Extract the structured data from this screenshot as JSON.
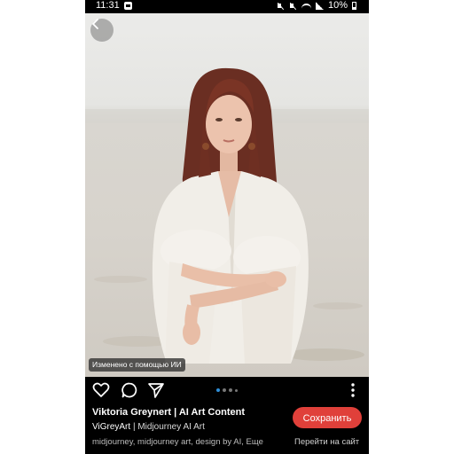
{
  "status_bar": {
    "time": "11:31",
    "battery": "10%"
  },
  "photo": {
    "ai_label": "Изменено с помощью ИИ"
  },
  "pagination": {
    "total": 4,
    "active_index": 0
  },
  "pin": {
    "title": "Viktoria Greynert | AI Art Content",
    "author_name": "ViGreyArt",
    "author_board": " | Midjourney AI Art",
    "tags": "midjourney, midjourney art, design by AI, Еще"
  },
  "buttons": {
    "save": "Сохранить",
    "visit": "Перейти на сайт"
  },
  "colors": {
    "save_button": "#e0403a",
    "active_dot": "#2f8fd8",
    "background": "#000000"
  }
}
